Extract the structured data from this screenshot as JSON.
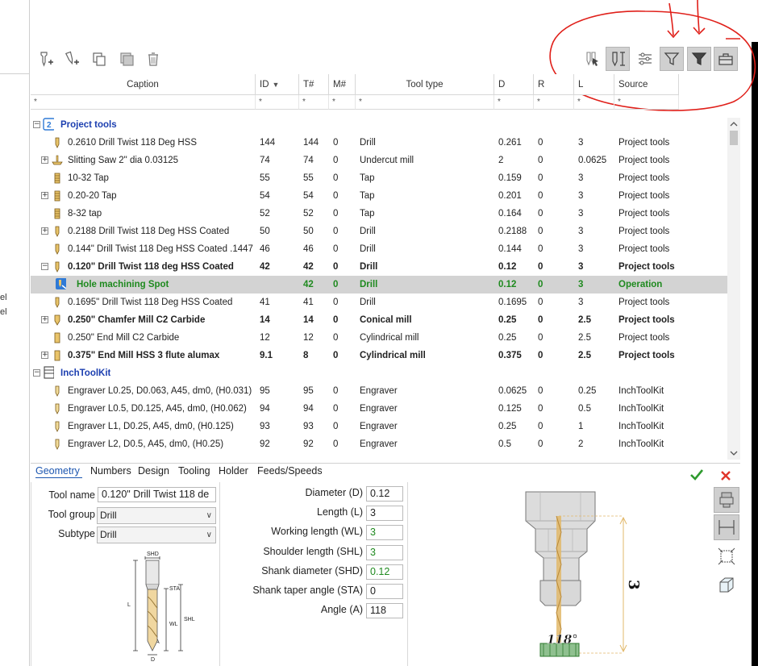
{
  "left_fragments": [
    "el",
    "el"
  ],
  "toolbar_left": [
    {
      "name": "new-tool-icon"
    },
    {
      "name": "new-tool-group-icon"
    },
    {
      "name": "copy-icon"
    },
    {
      "name": "paste-icon"
    },
    {
      "name": "delete-icon"
    }
  ],
  "toolbar_right": [
    {
      "name": "select-tool-icon",
      "active": false
    },
    {
      "name": "tool-dimensions-icon",
      "active": true
    },
    {
      "name": "settings-sliders-icon",
      "active": false
    },
    {
      "name": "filter-icon",
      "active": true
    },
    {
      "name": "filter-active-icon",
      "active": true
    },
    {
      "name": "toolbox-icon",
      "active": true
    }
  ],
  "columns": [
    {
      "label": "Caption",
      "sort": ""
    },
    {
      "label": "ID",
      "sort": "▼"
    },
    {
      "label": "T#",
      "sort": ""
    },
    {
      "label": "M#",
      "sort": ""
    },
    {
      "label": "Tool type",
      "sort": ""
    },
    {
      "label": "D",
      "sort": ""
    },
    {
      "label": "R",
      "sort": ""
    },
    {
      "label": "L",
      "sort": ""
    },
    {
      "label": "Source",
      "sort": ""
    }
  ],
  "filter_placeholder": "*",
  "groups": [
    {
      "name": "Project tools",
      "rows": [
        {
          "caption": "0.2610 Drill Twist 118 Deg HSS",
          "id": "144",
          "t": "144",
          "m": "0",
          "type": "Drill",
          "d": "0.261",
          "r": "0",
          "l": "3",
          "source": "Project tools",
          "expand": false,
          "icon": "drill",
          "style": ""
        },
        {
          "caption": "Slitting Saw 2\" dia 0.03125",
          "id": "74",
          "t": "74",
          "m": "0",
          "type": "Undercut mill",
          "d": "2",
          "r": "0",
          "l": "0.0625",
          "source": "Project tools",
          "expand": true,
          "icon": "saw",
          "style": ""
        },
        {
          "caption": "10-32 Tap",
          "id": "55",
          "t": "55",
          "m": "0",
          "type": "Tap",
          "d": "0.159",
          "r": "0",
          "l": "3",
          "source": "Project tools",
          "expand": false,
          "icon": "tap",
          "style": ""
        },
        {
          "caption": "0.20-20 Tap",
          "id": "54",
          "t": "54",
          "m": "0",
          "type": "Tap",
          "d": "0.201",
          "r": "0",
          "l": "3",
          "source": "Project tools",
          "expand": true,
          "icon": "tap",
          "style": ""
        },
        {
          "caption": "8-32 tap",
          "id": "52",
          "t": "52",
          "m": "0",
          "type": "Tap",
          "d": "0.164",
          "r": "0",
          "l": "3",
          "source": "Project tools",
          "expand": false,
          "icon": "tap",
          "style": ""
        },
        {
          "caption": "0.2188 Drill Twist 118 Deg HSS Coated",
          "id": "50",
          "t": "50",
          "m": "0",
          "type": "Drill",
          "d": "0.2188",
          "r": "0",
          "l": "3",
          "source": "Project tools",
          "expand": true,
          "icon": "drill",
          "style": ""
        },
        {
          "caption": "0.144\" Drill Twist 118 Deg HSS Coated .1447 ...",
          "id": "46",
          "t": "46",
          "m": "0",
          "type": "Drill",
          "d": "0.144",
          "r": "0",
          "l": "3",
          "source": "Project tools",
          "expand": false,
          "icon": "drill",
          "style": ""
        },
        {
          "caption": "0.120\" Drill Twist 118 deg HSS Coated",
          "id": "42",
          "t": "42",
          "m": "0",
          "type": "Drill",
          "d": "0.12",
          "r": "0",
          "l": "3",
          "source": "Project tools",
          "expand": "minus",
          "icon": "drill",
          "style": "bold"
        },
        {
          "caption": "Hole machining Spot",
          "id": "",
          "t": "42",
          "m": "0",
          "type": "Drill",
          "d": "0.12",
          "r": "0",
          "l": "3",
          "source": "Operation",
          "expand": false,
          "icon": "operation",
          "style": "green sel"
        },
        {
          "caption": "0.1695\" Drill Twist 118 Deg HSS Coated",
          "id": "41",
          "t": "41",
          "m": "0",
          "type": "Drill",
          "d": "0.1695",
          "r": "0",
          "l": "3",
          "source": "Project tools",
          "expand": false,
          "icon": "drill",
          "style": ""
        },
        {
          "caption": "0.250\" Chamfer Mill C2 Carbide",
          "id": "14",
          "t": "14",
          "m": "0",
          "type": "Conical mill",
          "d": "0.25",
          "r": "0",
          "l": "2.5",
          "source": "Project tools",
          "expand": true,
          "icon": "chamfer",
          "style": "bold"
        },
        {
          "caption": "0.250\" End Mill C2 Carbide",
          "id": "12",
          "t": "12",
          "m": "0",
          "type": "Cylindrical mill",
          "d": "0.25",
          "r": "0",
          "l": "2.5",
          "source": "Project tools",
          "expand": false,
          "icon": "endmill",
          "style": ""
        },
        {
          "caption": "0.375\" End Mill HSS 3 flute alumax",
          "id": "9.1",
          "t": "8",
          "m": "0",
          "type": "Cylindrical mill",
          "d": "0.375",
          "r": "0",
          "l": "2.5",
          "source": "Project tools",
          "expand": true,
          "icon": "endmill",
          "style": "bold"
        }
      ]
    },
    {
      "name": "InchToolKit",
      "rows": [
        {
          "caption": "Engraver L0.25, D0.063, A45, dm0, (H0.031)",
          "id": "95",
          "t": "95",
          "m": "0",
          "type": "Engraver",
          "d": "0.0625",
          "r": "0",
          "l": "0.25",
          "source": "InchToolKit",
          "expand": false,
          "icon": "engraver",
          "style": ""
        },
        {
          "caption": "Engraver L0.5, D0.125, A45, dm0, (H0.062)",
          "id": "94",
          "t": "94",
          "m": "0",
          "type": "Engraver",
          "d": "0.125",
          "r": "0",
          "l": "0.5",
          "source": "InchToolKit",
          "expand": false,
          "icon": "engraver",
          "style": ""
        },
        {
          "caption": "Engraver L1, D0.25, A45, dm0, (H0.125)",
          "id": "93",
          "t": "93",
          "m": "0",
          "type": "Engraver",
          "d": "0.25",
          "r": "0",
          "l": "1",
          "source": "InchToolKit",
          "expand": false,
          "icon": "engraver",
          "style": ""
        },
        {
          "caption": "Engraver L2, D0.5, A45, dm0, (H0.25)",
          "id": "92",
          "t": "92",
          "m": "0",
          "type": "Engraver",
          "d": "0.5",
          "r": "0",
          "l": "2",
          "source": "InchToolKit",
          "expand": false,
          "icon": "engraver",
          "style": ""
        }
      ]
    }
  ],
  "tabs": [
    "Geometry",
    "Numbers",
    "Design",
    "Tooling",
    "Holder",
    "Feeds/Speeds"
  ],
  "form": {
    "tool_name_label": "Tool name",
    "tool_name_value": "0.120\" Drill Twist 118 de",
    "tool_group_label": "Tool group",
    "tool_group_value": "Drill",
    "subtype_label": "Subtype",
    "subtype_value": "Drill"
  },
  "params": [
    {
      "label": "Diameter (D)",
      "value": "0.12",
      "color": "normal"
    },
    {
      "label": "Length (L)",
      "value": "3",
      "color": "normal"
    },
    {
      "label": "Working length (WL)",
      "value": "3",
      "color": "green"
    },
    {
      "label": "Shoulder length (SHL)",
      "value": "3",
      "color": "green"
    },
    {
      "label": "Shank diameter (SHD)",
      "value": "0.12",
      "color": "green"
    },
    {
      "label": "Shank taper angle (STA)",
      "value": "0",
      "color": "normal"
    },
    {
      "label": "Angle (A)",
      "value": "118",
      "color": "normal"
    }
  ],
  "diagram_labels": {
    "shd": "SHD",
    "sta": "STA",
    "l": "L",
    "wl": "WL",
    "shl": "SHL",
    "a": "A",
    "d": "D"
  },
  "preview": {
    "length_label": "3",
    "angle_label": "118°"
  },
  "colors": {
    "accent": "#1c56b0",
    "green": "#1f8a1f",
    "annotation_red": "#e0201a",
    "group_blue": "#1c3fb0"
  }
}
